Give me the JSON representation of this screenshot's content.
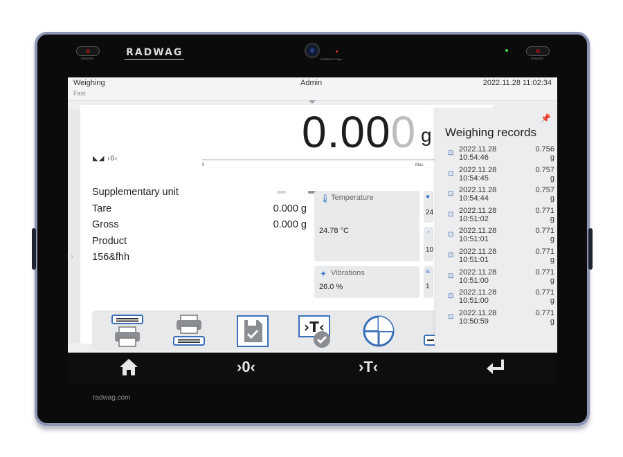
{
  "device": {
    "logo": "RADWAG",
    "sensor_label": "SENSOR",
    "camera_label": "CAMERA 8.0 Mpx",
    "website": "radwag.com"
  },
  "topbar": {
    "mode": "Weighing",
    "submode": "Fast",
    "user": "Admin",
    "datetime": "2022.11.28 11:02:34"
  },
  "display": {
    "reading_main": "0.00",
    "reading_last": "0",
    "unit": "g",
    "indicators": "◣◢ ›0‹",
    "bargraph_min": "0",
    "bargraph_max": "Max",
    "page_active": 2
  },
  "info": [
    {
      "label": "Supplementary unit",
      "value": ""
    },
    {
      "label": "Tare",
      "value": "0.000 g"
    },
    {
      "label": "Gross",
      "value": "0.000 g"
    },
    {
      "label": "Product",
      "value": ""
    },
    {
      "label": "156&fhh",
      "value": ""
    }
  ],
  "tiles": {
    "temperature": {
      "title": "Temperature",
      "value": "24.78 °C",
      "icon": "thermometer-icon"
    },
    "vibrations": {
      "title": "Vibrations",
      "value": "26.0 %",
      "icon": "vibration-icon"
    },
    "small": [
      {
        "icon": "humidity-icon",
        "value": "24"
      },
      {
        "icon": "pressure-icon",
        "value": "10"
      },
      {
        "icon": "level-icon",
        "value": "1"
      }
    ]
  },
  "toolbar": {
    "buttons": [
      "print-header-icon",
      "print-footer-icon",
      "save-icon",
      "tare-confirm-icon",
      "adjustment-icon",
      "partial-icon"
    ]
  },
  "records": {
    "title": "Weighing records",
    "items": [
      {
        "date": "2022.11.28",
        "time": "10:54:46",
        "value": "0.756",
        "unit": "g"
      },
      {
        "date": "2022.11.28",
        "time": "10:54:45",
        "value": "0.757",
        "unit": "g"
      },
      {
        "date": "2022.11.28",
        "time": "10:54:44",
        "value": "0.757",
        "unit": "g"
      },
      {
        "date": "2022.11.28",
        "time": "10:51:02",
        "value": "0.771",
        "unit": "g"
      },
      {
        "date": "2022.11.28",
        "time": "10:51:01",
        "value": "0.771",
        "unit": "g"
      },
      {
        "date": "2022.11.28",
        "time": "10:51:01",
        "value": "0.771",
        "unit": "g"
      },
      {
        "date": "2022.11.28",
        "time": "10:51:00",
        "value": "0.771",
        "unit": "g"
      },
      {
        "date": "2022.11.28",
        "time": "10:51:00",
        "value": "0.771",
        "unit": "g"
      },
      {
        "date": "2022.11.28",
        "time": "10:50:59",
        "value": "0.771",
        "unit": "g"
      }
    ]
  },
  "navbar": {
    "home": "home-icon",
    "zero": "›0‹",
    "tare": "›T‹",
    "enter": "enter-icon"
  },
  "colors": {
    "accent": "#3b6fb8",
    "bezel": "#8a96b4"
  }
}
